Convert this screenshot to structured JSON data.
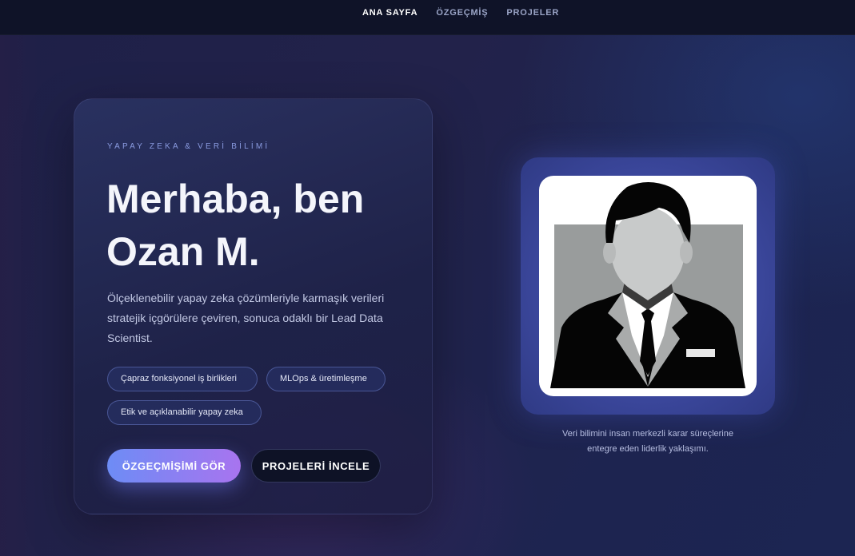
{
  "nav": {
    "items": [
      {
        "label": "ANA SAYFA",
        "active": true
      },
      {
        "label": "ÖZGEÇMİŞ",
        "active": false
      },
      {
        "label": "PROJELER",
        "active": false
      }
    ]
  },
  "hero": {
    "eyebrow": "YAPAY ZEKA & VERİ BİLİMİ",
    "headline_line1": "Merhaba, ben",
    "headline_line2": "Ozan M.",
    "description": "Ölçeklenebilir yapay zeka çözümleriyle karmaşık verileri stratejik içgörülere çeviren, sonuca odaklı bir Lead Data Scientist.",
    "chips": [
      "Çapraz fonksiyonel iş birlikleri",
      "MLOps & üretimleşme",
      "Etik ve açıklanabilir yapay zeka"
    ],
    "primary_button": "ÖZGEÇMİŞİMİ GÖR",
    "secondary_button": "PROJELERİ İNCELE"
  },
  "portrait": {
    "icon": "businessman-avatar-icon",
    "caption_line1": "Veri bilimini insan merkezli karar süreçlerine",
    "caption_line2": "entegre eden liderlik yaklaşımı."
  },
  "colors": {
    "accent_start": "#6d8cf5",
    "accent_end": "#a874ef",
    "nav_bg": "#0f1328",
    "eyebrow": "#8a9be0"
  }
}
